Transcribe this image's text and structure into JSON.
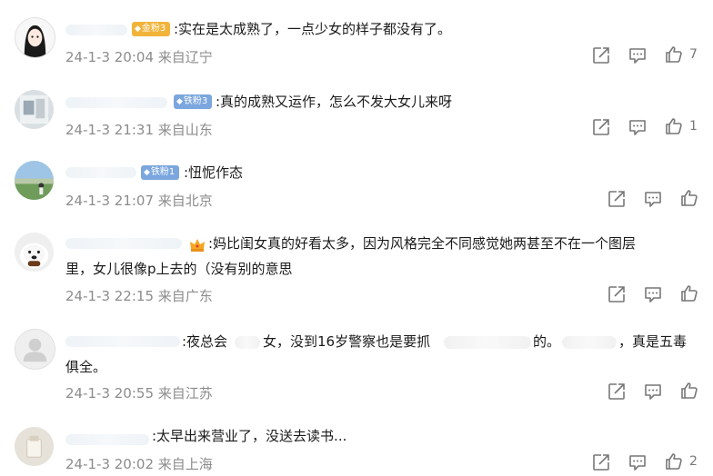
{
  "comments": [
    {
      "badge": "金粉3",
      "text": ":实在是太成熟了，一点少女的样子都没有了。",
      "meta": "24-1-3 20:04 来自辽宁",
      "likes": "7"
    },
    {
      "badge": "铁粉3",
      "text": ":真的成熟又运作，怎么不发大女儿来呀",
      "meta": "24-1-3 21:31 来自山东",
      "likes": "1"
    },
    {
      "badge": "铁粉1",
      "text": ":忸怩作态",
      "meta": "24-1-3 21:07 来自北京",
      "likes": ""
    },
    {
      "badge": "",
      "text_line1": ":妈比闺女真的好看太多，因为风格完全不同感觉她两甚至不在一个图层",
      "text_line2": "里，女儿很像p上去的（没有别的意思",
      "meta": "24-1-3 22:15 来自广东",
      "likes": ""
    },
    {
      "badge": "",
      "text_a": ":夜总会",
      "text_b": "女，没到16岁警察也是要抓",
      "text_c": "的。",
      "text_d": "，真是五毒",
      "text_line2": "俱全。",
      "meta": "24-1-3 20:55 来自江苏",
      "likes": ""
    },
    {
      "badge": "",
      "text": ":太早出来营业了，没送去读书...",
      "meta": "24-1-3 20:02 来自上海",
      "likes": "2"
    }
  ],
  "icons": {
    "share": "share-icon",
    "comment": "comment-icon",
    "like": "thumbs-up-icon",
    "badge": "diamond-icon"
  }
}
